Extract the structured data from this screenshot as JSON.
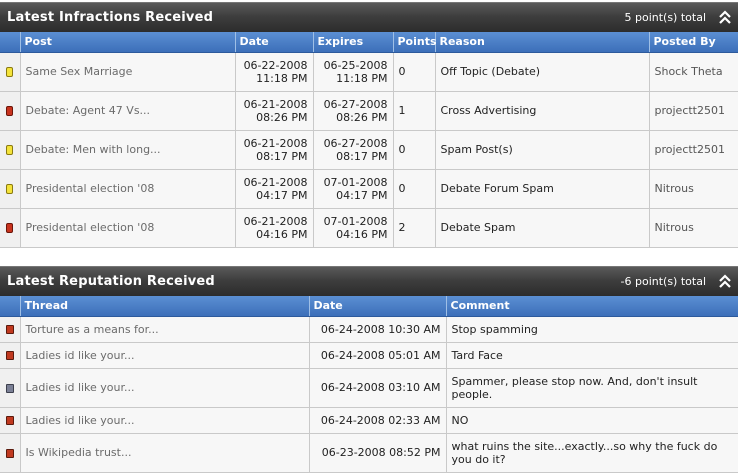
{
  "infractions": {
    "title": "Latest Infractions Received",
    "total": "5 point(s) total",
    "columns": [
      "Post",
      "Date",
      "Expires",
      "Points",
      "Reason",
      "Posted By"
    ],
    "rows": [
      {
        "status": "yellow",
        "post": "Same Sex Marriage",
        "date": "06-22-2008",
        "date_time": "11:18 PM",
        "expires": "06-25-2008",
        "expires_time": "11:18 PM",
        "points": "0",
        "reason": "Off Topic (Debate)",
        "posted_by": "Shock Theta"
      },
      {
        "status": "red",
        "post": "Debate: Agent 47 Vs...",
        "date": "06-21-2008",
        "date_time": "08:26 PM",
        "expires": "06-27-2008",
        "expires_time": "08:26 PM",
        "points": "1",
        "reason": "Cross Advertising",
        "posted_by": "projectt2501"
      },
      {
        "status": "yellow",
        "post": "Debate: Men with long...",
        "date": "06-21-2008",
        "date_time": "08:17 PM",
        "expires": "06-27-2008",
        "expires_time": "08:17 PM",
        "points": "0",
        "reason": "Spam Post(s)",
        "posted_by": "projectt2501"
      },
      {
        "status": "yellow",
        "post": "Presidental election '08",
        "date": "06-21-2008",
        "date_time": "04:17 PM",
        "expires": "07-01-2008",
        "expires_time": "04:17 PM",
        "points": "0",
        "reason": "Debate Forum Spam",
        "posted_by": "Nitrous"
      },
      {
        "status": "red",
        "post": "Presidental election '08",
        "date": "06-21-2008",
        "date_time": "04:16 PM",
        "expires": "07-01-2008",
        "expires_time": "04:16 PM",
        "points": "2",
        "reason": "Debate Spam",
        "posted_by": "Nitrous"
      }
    ]
  },
  "reputation": {
    "title": "Latest Reputation Received",
    "total": "-6 point(s) total",
    "columns": [
      "Thread",
      "Date",
      "Comment"
    ],
    "rows": [
      {
        "status": "red",
        "thread": "Torture as a means for...",
        "date": "06-24-2008 10:30 AM",
        "comment": "Stop spamming"
      },
      {
        "status": "red",
        "thread": "Ladies id like your...",
        "date": "06-24-2008 05:01 AM",
        "comment": "Tard Face"
      },
      {
        "status": "gray",
        "thread": "Ladies id like your...",
        "date": "06-24-2008 03:10 AM",
        "comment": "Spammer, please stop now. And, don't insult people."
      },
      {
        "status": "red",
        "thread": "Ladies id like your...",
        "date": "06-24-2008 02:33 AM",
        "comment": "NO"
      },
      {
        "status": "red",
        "thread": "Is Wikipedia trust...",
        "date": "06-23-2008 08:52 PM",
        "comment": "what ruins the site...exactly...so why the fuck do you do it?"
      }
    ]
  },
  "icons": {
    "collapse": "collapse-up-icon",
    "infraction_status": "infraction-status-icon",
    "reputation_status": "reputation-status-icon"
  },
  "colors": {
    "header_bar": "#3e3e3e",
    "column_header": "#4a7cc4",
    "yellow_status": "#f4e33a",
    "red_status": "#c8331e",
    "gray_status": "#7a7f95"
  }
}
